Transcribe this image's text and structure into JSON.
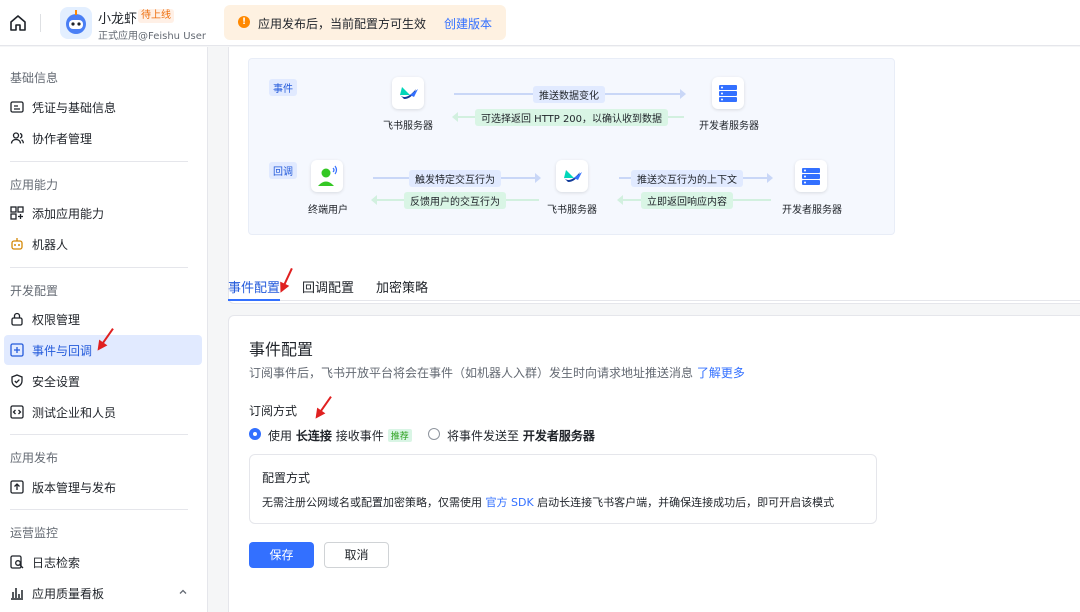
{
  "topbar": {
    "app_name": "小龙虾",
    "app_badge": "待上线",
    "app_sub": "正式应用@Feishu User",
    "notice_text": "应用发布后，当前配置方可生效",
    "notice_icon": "!",
    "notice_link": "创建版本"
  },
  "sidebar": {
    "sections": [
      {
        "title": "基础信息",
        "items": [
          {
            "label": "凭证与基础信息",
            "icon": "id-card-icon"
          },
          {
            "label": "协作者管理",
            "icon": "users-icon"
          }
        ]
      },
      {
        "title": "应用能力",
        "items": [
          {
            "label": "添加应用能力",
            "icon": "grid-plus-icon"
          },
          {
            "label": "机器人",
            "icon": "robot-icon"
          }
        ]
      },
      {
        "title": "开发配置",
        "items": [
          {
            "label": "权限管理",
            "icon": "lock-icon"
          },
          {
            "label": "事件与回调",
            "icon": "event-icon",
            "active": true
          },
          {
            "label": "安全设置",
            "icon": "shield-icon"
          },
          {
            "label": "测试企业和人员",
            "icon": "code-icon"
          }
        ]
      },
      {
        "title": "应用发布",
        "items": [
          {
            "label": "版本管理与发布",
            "icon": "upload-icon"
          }
        ]
      },
      {
        "title": "运营监控",
        "items": [
          {
            "label": "日志检索",
            "icon": "log-search-icon"
          },
          {
            "label": "应用质量看板",
            "icon": "chart-icon"
          }
        ]
      }
    ]
  },
  "flow": {
    "event_tag": "事件",
    "callback_tag": "回调",
    "feishu_server": "飞书服务器",
    "dev_server": "开发者服务器",
    "end_user": "终端用户",
    "event_push": "推送数据变化",
    "event_return": "可选择返回 HTTP 200，以确认收到数据",
    "cb_trigger": "触发特定交互行为",
    "cb_feedback": "反馈用户的交互行为",
    "cb_push_ctx": "推送交互行为的上下文",
    "cb_return": "立即返回响应内容"
  },
  "tabs": [
    "事件配置",
    "回调配置",
    "加密策略"
  ],
  "config": {
    "title": "事件配置",
    "desc": "订阅事件后，飞书开放平台将会在事件（如机器人入群）发生时向请求地址推送消息",
    "desc_link": "了解更多",
    "sub_title": "订阅方式",
    "option1_pre": "使用",
    "option1_bold": "长连接",
    "option1_post": "接收事件",
    "option1_badge": "推荐",
    "option2_pre": "将事件发送至",
    "option2_bold": "开发者服务器",
    "mode_title": "配置方式",
    "mode_desc_pre": "无需注册公网域名或配置加密策略，仅需使用",
    "mode_link": "官方 SDK",
    "mode_desc_post": "启动长连接飞书客户端，并确保连接成功后，即可开启该模式",
    "save": "保存",
    "cancel": "取消"
  },
  "colors": {
    "accent": "#3370ff",
    "annotation": "#e02020"
  }
}
